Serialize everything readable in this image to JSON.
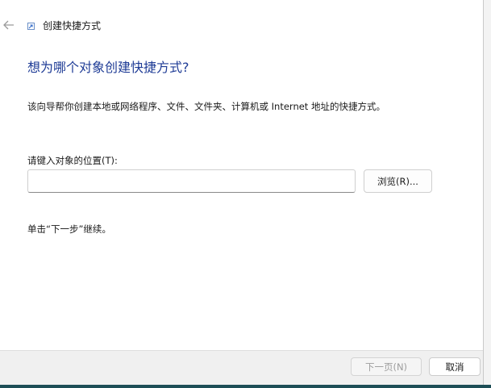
{
  "window": {
    "title": "创建快捷方式",
    "back_icon": "back-arrow-icon",
    "title_icon": "shortcut-icon"
  },
  "main": {
    "heading": "想为哪个对象创建快捷方式?",
    "description": "该向导帮你创建本地或网络程序、文件、文件夹、计算机或 Internet 地址的快捷方式。",
    "location_label": "请键入对象的位置(T):",
    "location_value": "",
    "browse_label": "浏览(R)...",
    "hint": "单击“下一步”继续。"
  },
  "footer": {
    "next_label": "下一页(N)",
    "cancel_label": "取消"
  },
  "colors": {
    "heading": "#1f3c96",
    "footer_bg": "#f0f0f0",
    "disabled_text": "#9d9d9d"
  }
}
